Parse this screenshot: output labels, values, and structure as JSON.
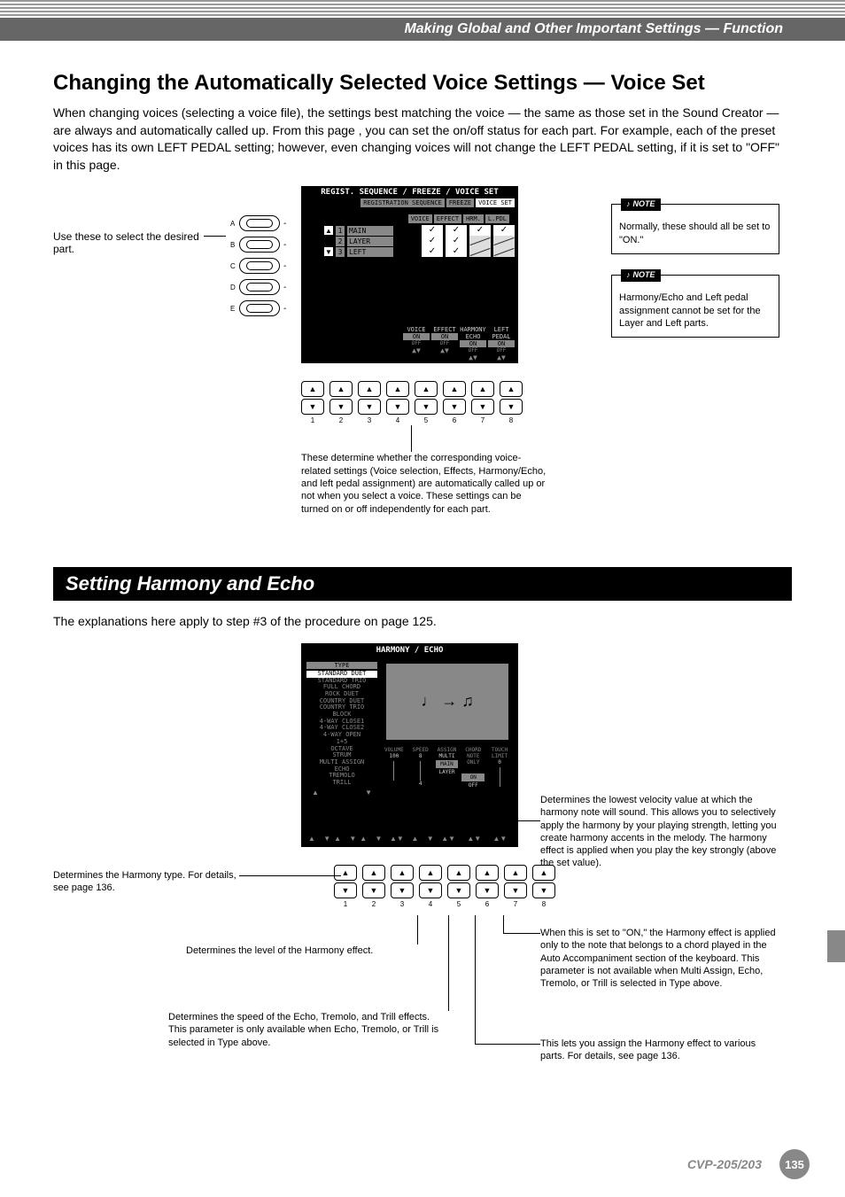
{
  "header": {
    "breadcrumb": "Making Global and Other Important Settings — Function"
  },
  "section1": {
    "title": "Changing the Automatically Selected Voice Settings — Voice Set",
    "intro": "When changing voices (selecting a voice file), the settings best matching the voice — the same as those set in the Sound Creator — are always and automatically called up.  From this page , you can set the on/off status for each part.  For example, each of the preset voices has its own LEFT PEDAL setting; however, even changing voices will not change the LEFT PEDAL setting, if it is set to \"OFF\" in this page.",
    "select_part_label": "Use these to select the desired part.",
    "side_button_labels": [
      "A",
      "B",
      "C",
      "D",
      "E"
    ],
    "display": {
      "title": "REGIST. SEQUENCE / FREEZE / VOICE SET",
      "tabs": [
        "REGISTRATION SEQUENCE",
        "FREEZE",
        "VOICE SET"
      ],
      "columns": [
        "VOICE",
        "EFFECT",
        "HRM.",
        "L.PDL"
      ],
      "rows": [
        {
          "idx": "1",
          "name": "MAIN",
          "cells": [
            "check",
            "check",
            "check",
            "check"
          ]
        },
        {
          "idx": "2",
          "name": "LAYER",
          "cells": [
            "check",
            "check",
            "disabled",
            "disabled"
          ]
        },
        {
          "idx": "3",
          "name": "LEFT",
          "cells": [
            "check",
            "check",
            "disabled",
            "disabled"
          ]
        }
      ],
      "bottom_labels": [
        "VOICE",
        "EFFECT",
        "HARMONY ECHO",
        "LEFT PEDAL"
      ],
      "on_label": "ON",
      "off_label": "OFF"
    },
    "bottom_numbers": [
      "1",
      "2",
      "3",
      "4",
      "5",
      "6",
      "7",
      "8"
    ],
    "callout_below": "These determine whether the corresponding voice-related settings (Voice selection, Effects, Harmony/Echo, and left pedal assignment) are automatically called up or not when you select a voice. These settings can be turned on or off independently for each part.",
    "note1": {
      "label": "NOTE",
      "text": "Normally, these should all be set to \"ON.\""
    },
    "note2": {
      "label": "NOTE",
      "text": "Harmony/Echo and Left pedal assignment cannot be set for the Layer and Left parts."
    }
  },
  "section2": {
    "header": "Setting Harmony and Echo",
    "intro": "The explanations here apply to step #3 of the procedure on page 125.",
    "display": {
      "title": "HARMONY / ECHO",
      "type_head": "TYPE",
      "types": [
        "STANDARD DUET",
        "STANDARD TRIO",
        "FULL CHORD",
        "ROCK DUET",
        "COUNTRY DUET",
        "COUNTRY TRIO",
        "BLOCK",
        "4-WAY CLOSE1",
        "4-WAY CLOSE2",
        "4-WAY OPEN",
        "1+5",
        "OCTAVE",
        "STRUM",
        "MULTI ASSIGN",
        "ECHO",
        "TREMOLO",
        "TRILL"
      ],
      "params": {
        "volume": {
          "label": "VOLUME",
          "value": "100"
        },
        "speed": {
          "label": "SPEED",
          "value": "8",
          "sub": "4"
        },
        "assign": {
          "label": "ASSIGN",
          "value_top": "MULTI",
          "value_mid": "MAIN",
          "value_bot": "LAYER"
        },
        "chord": {
          "label": "CHORD NOTE ONLY",
          "value_on": "ON",
          "value_off": "OFF"
        },
        "touch": {
          "label": "TOUCH LIMIT",
          "value": "0"
        }
      },
      "preview_symbols": "♩ → ♫"
    },
    "bottom_numbers": [
      "1",
      "2",
      "3",
      "4",
      "5",
      "6",
      "7",
      "8"
    ],
    "anno_left1": "Determines the Harmony type. For details, see page 136.",
    "anno_left2": "Determines the level of the Harmony effect.",
    "anno_left3": "Determines the speed of the Echo, Tremolo, and Trill effects. This parameter is only available when Echo, Tremolo, or Trill is selected in Type above.",
    "anno_right1": "Determines the lowest velocity value at which the harmony note will sound. This allows you to selectively apply the harmony by your playing strength, letting you create harmony accents in the melody. The harmony effect is applied when you play the key strongly (above the set value).",
    "anno_right2": "When this is set to \"ON,\" the Harmony effect is applied only to the note that belongs to a chord played in the Auto Accompaniment section of the keyboard. This parameter is not available when Multi Assign, Echo, Tremolo, or Trill is selected in Type above.",
    "anno_right3": "This lets you assign the Harmony effect to various parts. For details, see page 136."
  },
  "footer": {
    "model": "CVP-205/203",
    "page": "135"
  }
}
